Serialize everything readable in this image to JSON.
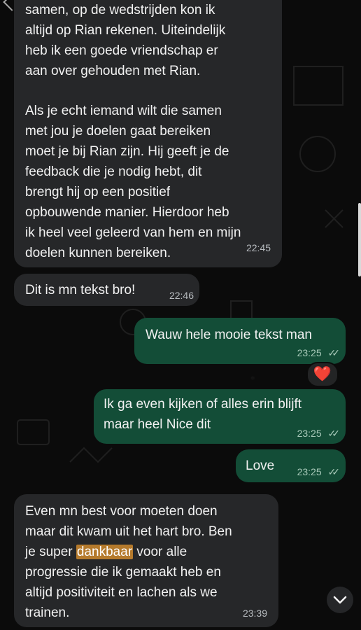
{
  "messages": [
    {
      "direction": "incoming",
      "text_lines": [
        "samen, op de wedstrijden kon ik",
        "altijd op Rian rekenen. Uiteindelijk",
        "heb ik een goede vriendschap er",
        "aan over gehouden met Rian."
      ],
      "paragraph2_lines": [
        "Als je echt iemand wilt die samen",
        "met jou je doelen gaat bereiken",
        "moet je bij Rian zijn. Hij geeft je de",
        "feedback die je nodig hebt, dit",
        "brengt hij op een positief",
        "opbouwende manier. Hierdoor heb",
        "ik heel veel geleerd van hem en mijn",
        "doelen kunnen bereiken."
      ],
      "time": "22:45"
    },
    {
      "direction": "incoming",
      "text": "Dit is mn tekst bro!",
      "time": "22:46"
    },
    {
      "direction": "outgoing",
      "text": "Wauw hele mooie tekst man",
      "time": "23:25"
    },
    {
      "direction": "outgoing",
      "text_lines": [
        "Ik ga even kijken of alles erin blijft",
        "maar heel Nice dit"
      ],
      "time": "23:25"
    },
    {
      "direction": "outgoing",
      "text": "Love",
      "time": "23:25"
    },
    {
      "direction": "incoming",
      "line1": "Even mn best voor moeten doen",
      "line2": "maar dit kwam uit het hart bro. Ben",
      "line3_before": "je super ",
      "line3_highlight": "dankbaar",
      "line3_after": " voor alle",
      "line4": "progressie die ik gemaakt heb en",
      "line5": "altijd positiviteit en lachen als we",
      "line6": "trainen.",
      "time": "23:39"
    }
  ],
  "reaction": {
    "emoji": "❤️"
  },
  "icons": {
    "read_receipt": "double-check-icon",
    "scroll_down": "chevron-down-icon",
    "back": "back-arrow-icon",
    "avatar": "avatar-image"
  },
  "colors": {
    "background": "#0b0b0b",
    "incoming_bubble": "#262729",
    "outgoing_bubble": "#134d37",
    "highlight": "#b57a2c",
    "reaction_heart": "#ff2a2a"
  }
}
